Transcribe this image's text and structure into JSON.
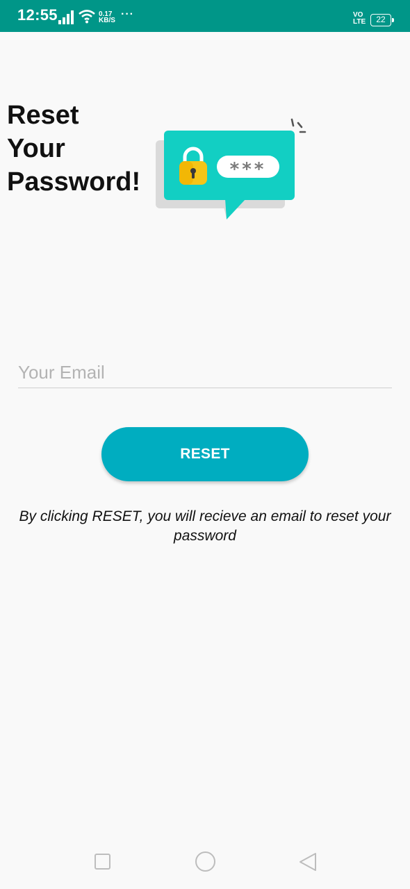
{
  "status_bar": {
    "time": "12:55",
    "speed_value": "0.17",
    "speed_unit": "KB/S",
    "more": "···",
    "volte_top": "VO",
    "volte_bottom": "LTE",
    "battery": "22"
  },
  "page": {
    "title_line1": "Reset",
    "title_line2": "Your",
    "title_line3": "Password!"
  },
  "illustration": {
    "masked_text": "***",
    "colors": {
      "bubble": "#12cfc3",
      "shadow": "#dadada",
      "lock": "#f5c518"
    }
  },
  "form": {
    "email_placeholder": "Your Email",
    "email_value": "",
    "reset_label": "RESET",
    "info_text": "By clicking RESET, you will recieve an email to reset your password"
  },
  "colors": {
    "status_bar": "#009688",
    "accent": "#00adc0"
  }
}
